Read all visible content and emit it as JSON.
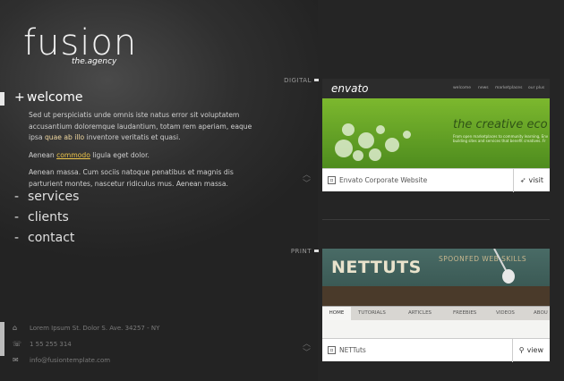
{
  "brand": {
    "name": "fusion",
    "tagline": "the.agency"
  },
  "nav": {
    "active": {
      "label": "welcome",
      "prefix": "+"
    },
    "items": [
      {
        "label": "services",
        "prefix": "-"
      },
      {
        "label": "clients",
        "prefix": "-"
      },
      {
        "label": "contact",
        "prefix": "-"
      }
    ]
  },
  "welcome": {
    "p1_a": "Sed ut perspiciatis unde omnis iste natus error sit voluptatem accusantium doloremque laudantium, totam rem aperiam, eaque ipsa ",
    "p1_b": "quae ab illo",
    "p1_c": " inventore veritatis et quasi.",
    "p2_a": "Aenean ",
    "p2_link": "commodo",
    "p2_b": " ligula eget dolor.",
    "p3": "Aenean massa. Cum sociis natoque penatibus et magnis dis parturient montes, nascetur ridiculus mus. Aenean massa."
  },
  "contact_info": {
    "address": "Lorem Ipsum St. Dolor S. Ave. 34257 - NY",
    "phone": "1 55 255 314",
    "email": "info@fusiontemplate.com"
  },
  "sections": [
    {
      "label": "DIGITAL",
      "card": {
        "caption": "Envato Corporate Website",
        "button": "visit",
        "thumb": {
          "logo": "envato",
          "nav": [
            "welcome",
            "news",
            "marketplaces",
            "our plus"
          ],
          "headline": "the creative eco",
          "sub1": "From open marketplaces to community learning, Env",
          "sub2": "building sites and services that benefit creatives. Fr"
        }
      }
    },
    {
      "label": "PRINT",
      "card": {
        "caption": "NETTuts",
        "button": "view",
        "thumb": {
          "logo": "NETTUTS",
          "tagline": "SPOONFED WEB SKILLS",
          "nav": [
            "HOME",
            "TUTORIALS",
            "ARTICLES",
            "FREEBIES",
            "VIDEOS",
            "ABOU"
          ]
        }
      }
    }
  ],
  "colors": {
    "accent": "#f0c74a",
    "background": "#2b2b2b",
    "highlight": "#f0d8a0"
  }
}
